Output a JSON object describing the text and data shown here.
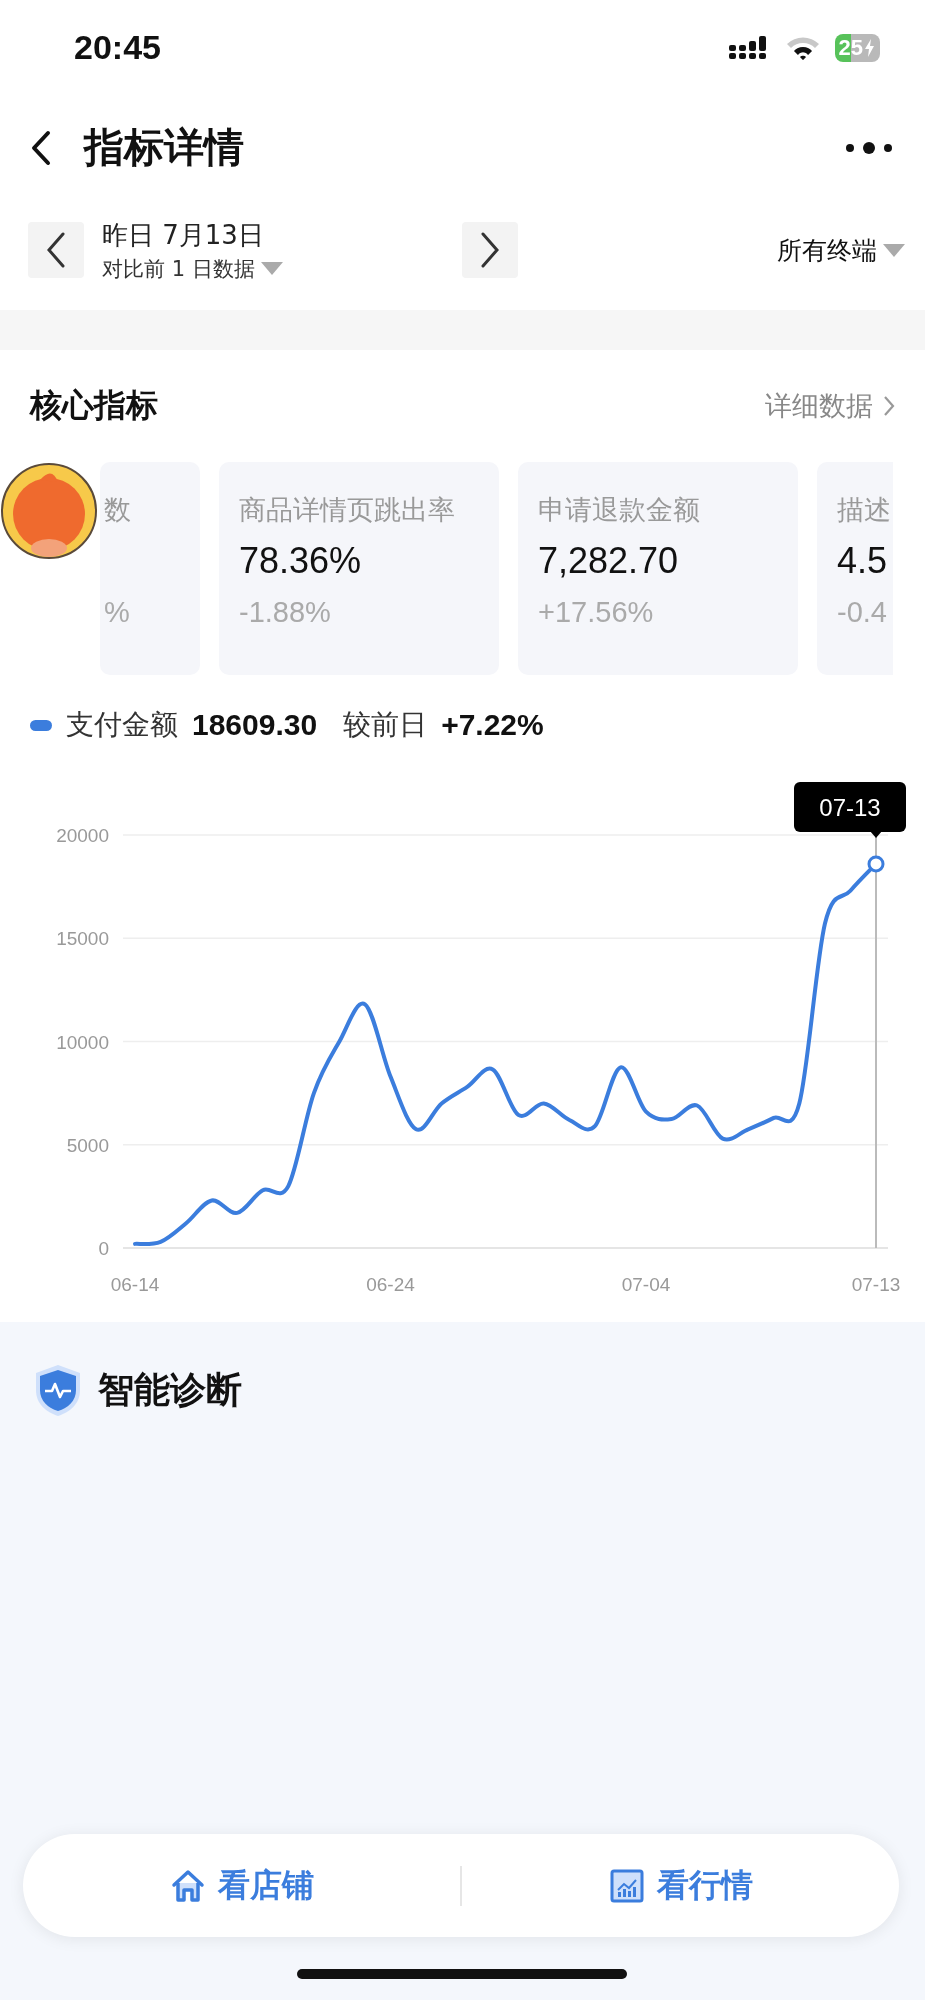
{
  "status_bar": {
    "time": "20:45",
    "battery": "25"
  },
  "nav": {
    "title": "指标详情"
  },
  "date_bar": {
    "date": "昨日 7月13日",
    "compare": "对比前 1 日数据",
    "terminal": "所有终端"
  },
  "core_metrics": {
    "title": "核心指标",
    "detail_link": "详细数据",
    "cards": [
      {
        "label": "数",
        "change": "%"
      },
      {
        "label": "商品详情页跳出率",
        "value": "78.36%",
        "change": "-1.88%"
      },
      {
        "label": "申请退款金额",
        "value": "7,282.70",
        "change": "+17.56%"
      },
      {
        "label": "描述",
        "value": "4.5",
        "change": "-0.4"
      }
    ],
    "legend": {
      "value": "18609.30",
      "compare_label": "较前日",
      "compare_value": "+7.22%"
    },
    "chart_data": {
      "type": "line",
      "categories": [
        "06-14",
        null,
        null,
        null,
        null,
        null,
        null,
        null,
        null,
        null,
        "06-24",
        null,
        null,
        null,
        null,
        null,
        null,
        null,
        null,
        null,
        "07-04",
        null,
        null,
        null,
        null,
        null,
        null,
        null,
        null,
        "07-13"
      ],
      "series": [
        {
          "name": "支付金额",
          "color": "#3b7ddd",
          "values": [
            200,
            300,
            1200,
            2300,
            1700,
            2800,
            3000,
            7500,
            10000,
            11800,
            8300,
            5750,
            7000,
            7800,
            8650,
            6450,
            7000,
            6200,
            5900,
            8750,
            6600,
            6250,
            6900,
            5300,
            5750,
            6300,
            7000,
            15700,
            17300,
            18600
          ]
        }
      ],
      "ylim": [
        0,
        20000
      ],
      "yticks": [
        0,
        5000,
        10000,
        15000,
        20000
      ],
      "grid": true,
      "annotations": [
        "07-13"
      ]
    }
  },
  "diagnosis": {
    "title": "智能诊断"
  },
  "bottom_bar": [
    {
      "label": "看店铺"
    },
    {
      "label": "看行情"
    }
  ]
}
